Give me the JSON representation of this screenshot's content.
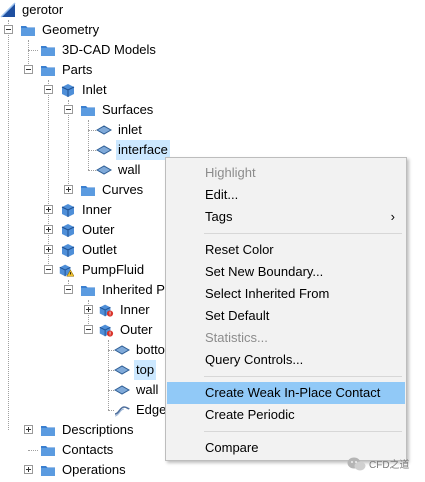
{
  "tree": {
    "root": "gerotor",
    "geometry": "Geometry",
    "cad_models": "3D-CAD Models",
    "parts": "Parts",
    "inlet": "Inlet",
    "surfaces": "Surfaces",
    "surf_inlet": "inlet",
    "surf_interface": "interface",
    "surf_wall": "wall",
    "curves": "Curves",
    "inner": "Inner",
    "outer": "Outer",
    "outlet": "Outlet",
    "pumpfluid": "PumpFluid",
    "inherited": "Inherited P",
    "pf_inner": "Inner",
    "pf_outer": "Outer",
    "pf_bottom": "botto",
    "pf_top": "top",
    "pf_wall": "wall",
    "pf_edges": "Edge",
    "descriptions": "Descriptions",
    "contacts": "Contacts",
    "operations": "Operations"
  },
  "context_menu": {
    "highlight": "Highlight",
    "edit": "Edit...",
    "tags": "Tags",
    "tags_arrow": "›",
    "reset_color": "Reset Color",
    "set_new_boundary": "Set New Boundary...",
    "select_inherited_from": "Select Inherited From",
    "set_default": "Set Default",
    "statistics": "Statistics...",
    "query_controls": "Query Controls...",
    "create_weak_contact": "Create Weak In-Place Contact",
    "create_periodic": "Create Periodic",
    "compare": "Compare"
  },
  "watermark": {
    "text": "CFD之道"
  },
  "colors": {
    "selection": "#cce8ff",
    "menu_highlight": "#91c9f7",
    "folder": "#3a7fd0"
  }
}
